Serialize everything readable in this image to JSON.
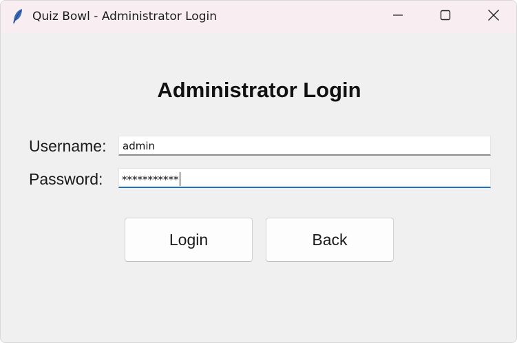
{
  "window": {
    "title": "Quiz Bowl - Administrator Login",
    "app_icon": "feather-icon",
    "controls": {
      "minimize": "minimize-icon",
      "maximize": "maximize-icon",
      "close": "close-icon"
    }
  },
  "form": {
    "heading": "Administrator Login",
    "username_label": "Username:",
    "username_value": "admin",
    "password_label": "Password:",
    "password_value": "***********"
  },
  "buttons": {
    "login": "Login",
    "back": "Back"
  },
  "colors": {
    "focus_accent": "#1f6fc4",
    "titlebar_bg": "#f8eef2",
    "window_bg": "#f0f0f0"
  }
}
